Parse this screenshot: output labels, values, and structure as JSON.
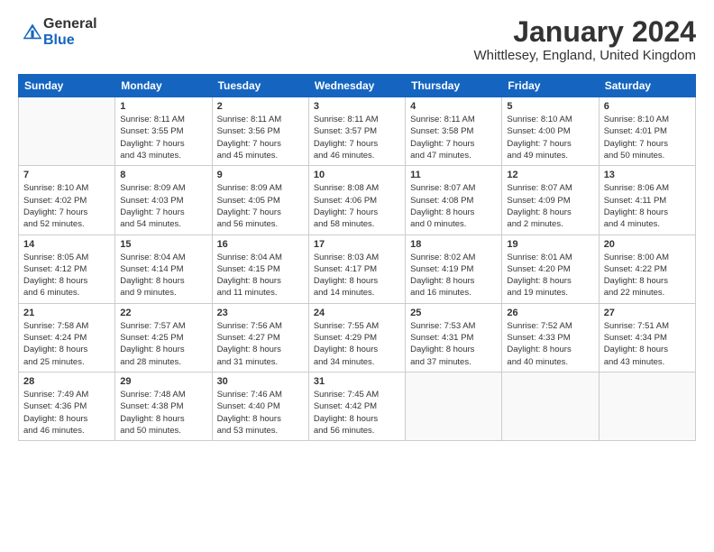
{
  "logo": {
    "general": "General",
    "blue": "Blue"
  },
  "title": "January 2024",
  "subtitle": "Whittlesey, England, United Kingdom",
  "days_of_week": [
    "Sunday",
    "Monday",
    "Tuesday",
    "Wednesday",
    "Thursday",
    "Friday",
    "Saturday"
  ],
  "weeks": [
    [
      {
        "day": "",
        "info": ""
      },
      {
        "day": "1",
        "info": "Sunrise: 8:11 AM\nSunset: 3:55 PM\nDaylight: 7 hours\nand 43 minutes."
      },
      {
        "day": "2",
        "info": "Sunrise: 8:11 AM\nSunset: 3:56 PM\nDaylight: 7 hours\nand 45 minutes."
      },
      {
        "day": "3",
        "info": "Sunrise: 8:11 AM\nSunset: 3:57 PM\nDaylight: 7 hours\nand 46 minutes."
      },
      {
        "day": "4",
        "info": "Sunrise: 8:11 AM\nSunset: 3:58 PM\nDaylight: 7 hours\nand 47 minutes."
      },
      {
        "day": "5",
        "info": "Sunrise: 8:10 AM\nSunset: 4:00 PM\nDaylight: 7 hours\nand 49 minutes."
      },
      {
        "day": "6",
        "info": "Sunrise: 8:10 AM\nSunset: 4:01 PM\nDaylight: 7 hours\nand 50 minutes."
      }
    ],
    [
      {
        "day": "7",
        "info": "Sunrise: 8:10 AM\nSunset: 4:02 PM\nDaylight: 7 hours\nand 52 minutes."
      },
      {
        "day": "8",
        "info": "Sunrise: 8:09 AM\nSunset: 4:03 PM\nDaylight: 7 hours\nand 54 minutes."
      },
      {
        "day": "9",
        "info": "Sunrise: 8:09 AM\nSunset: 4:05 PM\nDaylight: 7 hours\nand 56 minutes."
      },
      {
        "day": "10",
        "info": "Sunrise: 8:08 AM\nSunset: 4:06 PM\nDaylight: 7 hours\nand 58 minutes."
      },
      {
        "day": "11",
        "info": "Sunrise: 8:07 AM\nSunset: 4:08 PM\nDaylight: 8 hours\nand 0 minutes."
      },
      {
        "day": "12",
        "info": "Sunrise: 8:07 AM\nSunset: 4:09 PM\nDaylight: 8 hours\nand 2 minutes."
      },
      {
        "day": "13",
        "info": "Sunrise: 8:06 AM\nSunset: 4:11 PM\nDaylight: 8 hours\nand 4 minutes."
      }
    ],
    [
      {
        "day": "14",
        "info": "Sunrise: 8:05 AM\nSunset: 4:12 PM\nDaylight: 8 hours\nand 6 minutes."
      },
      {
        "day": "15",
        "info": "Sunrise: 8:04 AM\nSunset: 4:14 PM\nDaylight: 8 hours\nand 9 minutes."
      },
      {
        "day": "16",
        "info": "Sunrise: 8:04 AM\nSunset: 4:15 PM\nDaylight: 8 hours\nand 11 minutes."
      },
      {
        "day": "17",
        "info": "Sunrise: 8:03 AM\nSunset: 4:17 PM\nDaylight: 8 hours\nand 14 minutes."
      },
      {
        "day": "18",
        "info": "Sunrise: 8:02 AM\nSunset: 4:19 PM\nDaylight: 8 hours\nand 16 minutes."
      },
      {
        "day": "19",
        "info": "Sunrise: 8:01 AM\nSunset: 4:20 PM\nDaylight: 8 hours\nand 19 minutes."
      },
      {
        "day": "20",
        "info": "Sunrise: 8:00 AM\nSunset: 4:22 PM\nDaylight: 8 hours\nand 22 minutes."
      }
    ],
    [
      {
        "day": "21",
        "info": "Sunrise: 7:58 AM\nSunset: 4:24 PM\nDaylight: 8 hours\nand 25 minutes."
      },
      {
        "day": "22",
        "info": "Sunrise: 7:57 AM\nSunset: 4:25 PM\nDaylight: 8 hours\nand 28 minutes."
      },
      {
        "day": "23",
        "info": "Sunrise: 7:56 AM\nSunset: 4:27 PM\nDaylight: 8 hours\nand 31 minutes."
      },
      {
        "day": "24",
        "info": "Sunrise: 7:55 AM\nSunset: 4:29 PM\nDaylight: 8 hours\nand 34 minutes."
      },
      {
        "day": "25",
        "info": "Sunrise: 7:53 AM\nSunset: 4:31 PM\nDaylight: 8 hours\nand 37 minutes."
      },
      {
        "day": "26",
        "info": "Sunrise: 7:52 AM\nSunset: 4:33 PM\nDaylight: 8 hours\nand 40 minutes."
      },
      {
        "day": "27",
        "info": "Sunrise: 7:51 AM\nSunset: 4:34 PM\nDaylight: 8 hours\nand 43 minutes."
      }
    ],
    [
      {
        "day": "28",
        "info": "Sunrise: 7:49 AM\nSunset: 4:36 PM\nDaylight: 8 hours\nand 46 minutes."
      },
      {
        "day": "29",
        "info": "Sunrise: 7:48 AM\nSunset: 4:38 PM\nDaylight: 8 hours\nand 50 minutes."
      },
      {
        "day": "30",
        "info": "Sunrise: 7:46 AM\nSunset: 4:40 PM\nDaylight: 8 hours\nand 53 minutes."
      },
      {
        "day": "31",
        "info": "Sunrise: 7:45 AM\nSunset: 4:42 PM\nDaylight: 8 hours\nand 56 minutes."
      },
      {
        "day": "",
        "info": ""
      },
      {
        "day": "",
        "info": ""
      },
      {
        "day": "",
        "info": ""
      }
    ]
  ]
}
